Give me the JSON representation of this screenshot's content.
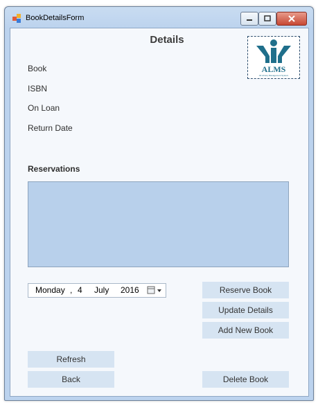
{
  "window": {
    "title": "BookDetailsForm"
  },
  "heading": "Details",
  "logo": {
    "text": "ALMS",
    "subtext": "All Library Management System"
  },
  "fields": {
    "book_label": "Book",
    "isbn_label": "ISBN",
    "on_loan_label": "On Loan",
    "return_date_label": "Return Date"
  },
  "reservations": {
    "label": "Reservations",
    "items": []
  },
  "date_picker": {
    "weekday": "Monday",
    "separator": ",",
    "day": "4",
    "month": "July",
    "year": "2016"
  },
  "buttons": {
    "reserve": "Reserve Book",
    "update": "Update Details",
    "add_new": "Add New Book",
    "refresh": "Refresh",
    "back": "Back",
    "delete": "Delete Book"
  },
  "colors": {
    "accent": "#1f6f8b",
    "button_bg": "#d6e4f2",
    "listbox_bg": "#b8d0eb",
    "form_bg": "#f5f8fc"
  }
}
